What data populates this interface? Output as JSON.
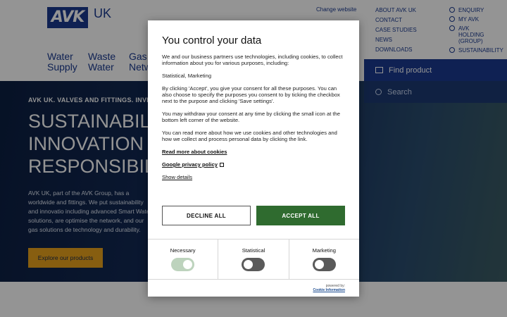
{
  "site": {
    "logo_text": "AVK",
    "logo_country": "UK",
    "change_website": "Change website",
    "main_nav": [
      "Water\nSupply",
      "Waste\nWater",
      "Gas\nNetw"
    ],
    "top_nav_col1": [
      "ABOUT AVK UK",
      "CONTACT",
      "CASE STUDIES",
      "NEWS",
      "DOWNLOADS"
    ],
    "top_nav_col2": [
      {
        "label": "ENQUIRY",
        "icon": "question-icon"
      },
      {
        "label": "MY AVK",
        "icon": "user-icon"
      },
      {
        "label": "AVK HOLDING (GROUP)",
        "icon": "globe-icon"
      },
      {
        "label": "SUSTAINABILITY",
        "icon": "leaf-icon"
      }
    ],
    "find_product": "Find product",
    "search": "Search",
    "hero_kicker": "AVK UK. VALVES AND FITTINGS. INVES",
    "hero_title": "SUSTAINABILIT\nINNOVATION &\nRESPONSIBILIT",
    "hero_text": "AVK UK, part of the AVK Group, has a worldwide and fittings. We put sustainability and innovatio including advanced Smart Water solutions, are optimise the network, and our gas solutions de technology and durability.",
    "hero_button": "Explore our products",
    "colors": {
      "brand_blue": "#1a3a8f",
      "accent_orange": "#e8a21c"
    }
  },
  "cookie_modal": {
    "title": "You control your data",
    "p1": "We and our business partners use technologies, including cookies, to collect information about you for various purposes, including:",
    "p2": "Statistical, Marketing",
    "p3": "By clicking 'Accept', you give your consent for all these purposes. You can also choose to specify the purposes you consent to by ticking the checkbox next to the purpose and clicking 'Save settings'.",
    "p4": "You may withdraw your consent at any time by clicking the small icon at the bottom left corner of the website.",
    "p5": "You can read more about how we use cookies and other technologies and how we collect and process personal data by clicking the link.",
    "link_cookies": "Read more about cookies",
    "link_privacy": "Google privacy policy",
    "link_details": "Show details",
    "decline_label": "DECLINE ALL",
    "accept_label": "ACCEPT ALL",
    "consents": [
      {
        "label": "Necessary",
        "enabled": true
      },
      {
        "label": "Statistical",
        "enabled": false
      },
      {
        "label": "Marketing",
        "enabled": false
      }
    ],
    "powered_by": "powered by:",
    "powered_brand": "Cookie Information",
    "colors": {
      "accept_green": "#2f6b2f"
    }
  }
}
